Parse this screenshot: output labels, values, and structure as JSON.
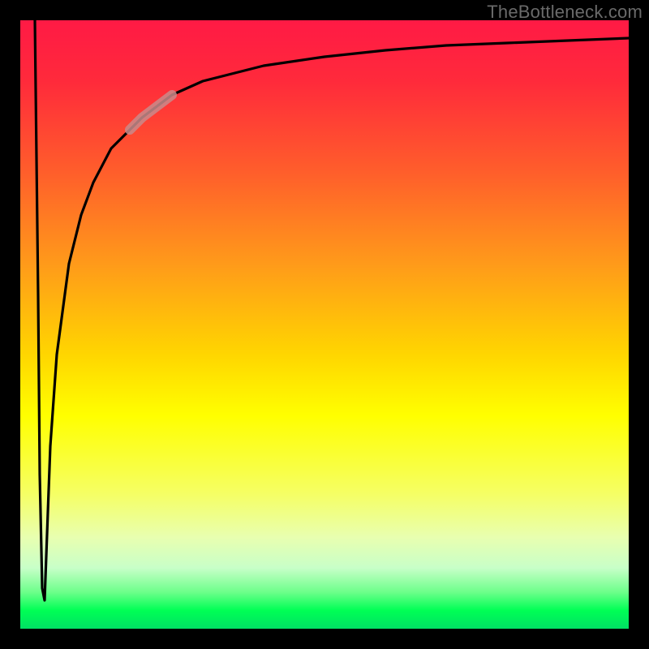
{
  "watermark": "TheBottleneck.com",
  "colors": {
    "curve": "#000000",
    "highlight": "#c98b8b",
    "background_frame": "#000000"
  },
  "chart_data": {
    "type": "line",
    "title": "",
    "xlabel": "",
    "ylabel": "",
    "xlim": [
      0,
      100
    ],
    "ylim": [
      0,
      100
    ],
    "series": [
      {
        "name": "curve",
        "x": [
          2.5,
          3.0,
          3.3,
          3.6,
          4.0,
          5.0,
          6.0,
          8.0,
          10,
          12,
          15,
          18,
          20,
          25,
          30,
          40,
          50,
          60,
          70,
          80,
          90,
          100
        ],
        "y": [
          100,
          55,
          25,
          8,
          5,
          30,
          45,
          60,
          68,
          74,
          79,
          82,
          84,
          88,
          90,
          92.5,
          94,
          95,
          95.8,
          96.3,
          96.7,
          97
        ]
      }
    ],
    "highlight_segment": {
      "series": "curve",
      "x_start": 18,
      "x_end": 25,
      "y_start": 82,
      "y_end": 88
    },
    "background_gradient_stops": [
      {
        "pos": 0,
        "color": "#ff1a45"
      },
      {
        "pos": 25,
        "color": "#ff5e2b"
      },
      {
        "pos": 55,
        "color": "#ffd600"
      },
      {
        "pos": 78,
        "color": "#f5ff66"
      },
      {
        "pos": 97,
        "color": "#00ff55"
      },
      {
        "pos": 100,
        "color": "#00e064"
      }
    ]
  }
}
